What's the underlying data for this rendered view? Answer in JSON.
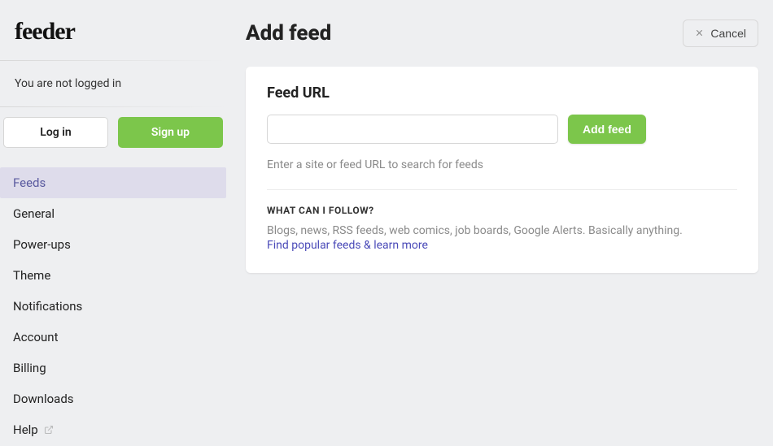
{
  "brand": "feeder",
  "status_text": "You are not logged in",
  "auth": {
    "login_label": "Log in",
    "signup_label": "Sign up"
  },
  "nav": {
    "items": [
      {
        "label": "Feeds",
        "active": true
      },
      {
        "label": "General"
      },
      {
        "label": "Power-ups"
      },
      {
        "label": "Theme"
      },
      {
        "label": "Notifications"
      },
      {
        "label": "Account"
      },
      {
        "label": "Billing"
      },
      {
        "label": "Downloads"
      },
      {
        "label": "Help",
        "external": true
      }
    ]
  },
  "page": {
    "title": "Add feed",
    "cancel_label": "Cancel"
  },
  "feed": {
    "section_label": "Feed URL",
    "input_value": "",
    "add_label": "Add feed",
    "hint": "Enter a site or feed URL to search for feeds"
  },
  "what": {
    "title": "WHAT CAN I FOLLOW?",
    "text": "Blogs, news, RSS feeds, web comics, job boards, Google Alerts. Basically anything.",
    "link": "Find popular feeds & learn more"
  }
}
